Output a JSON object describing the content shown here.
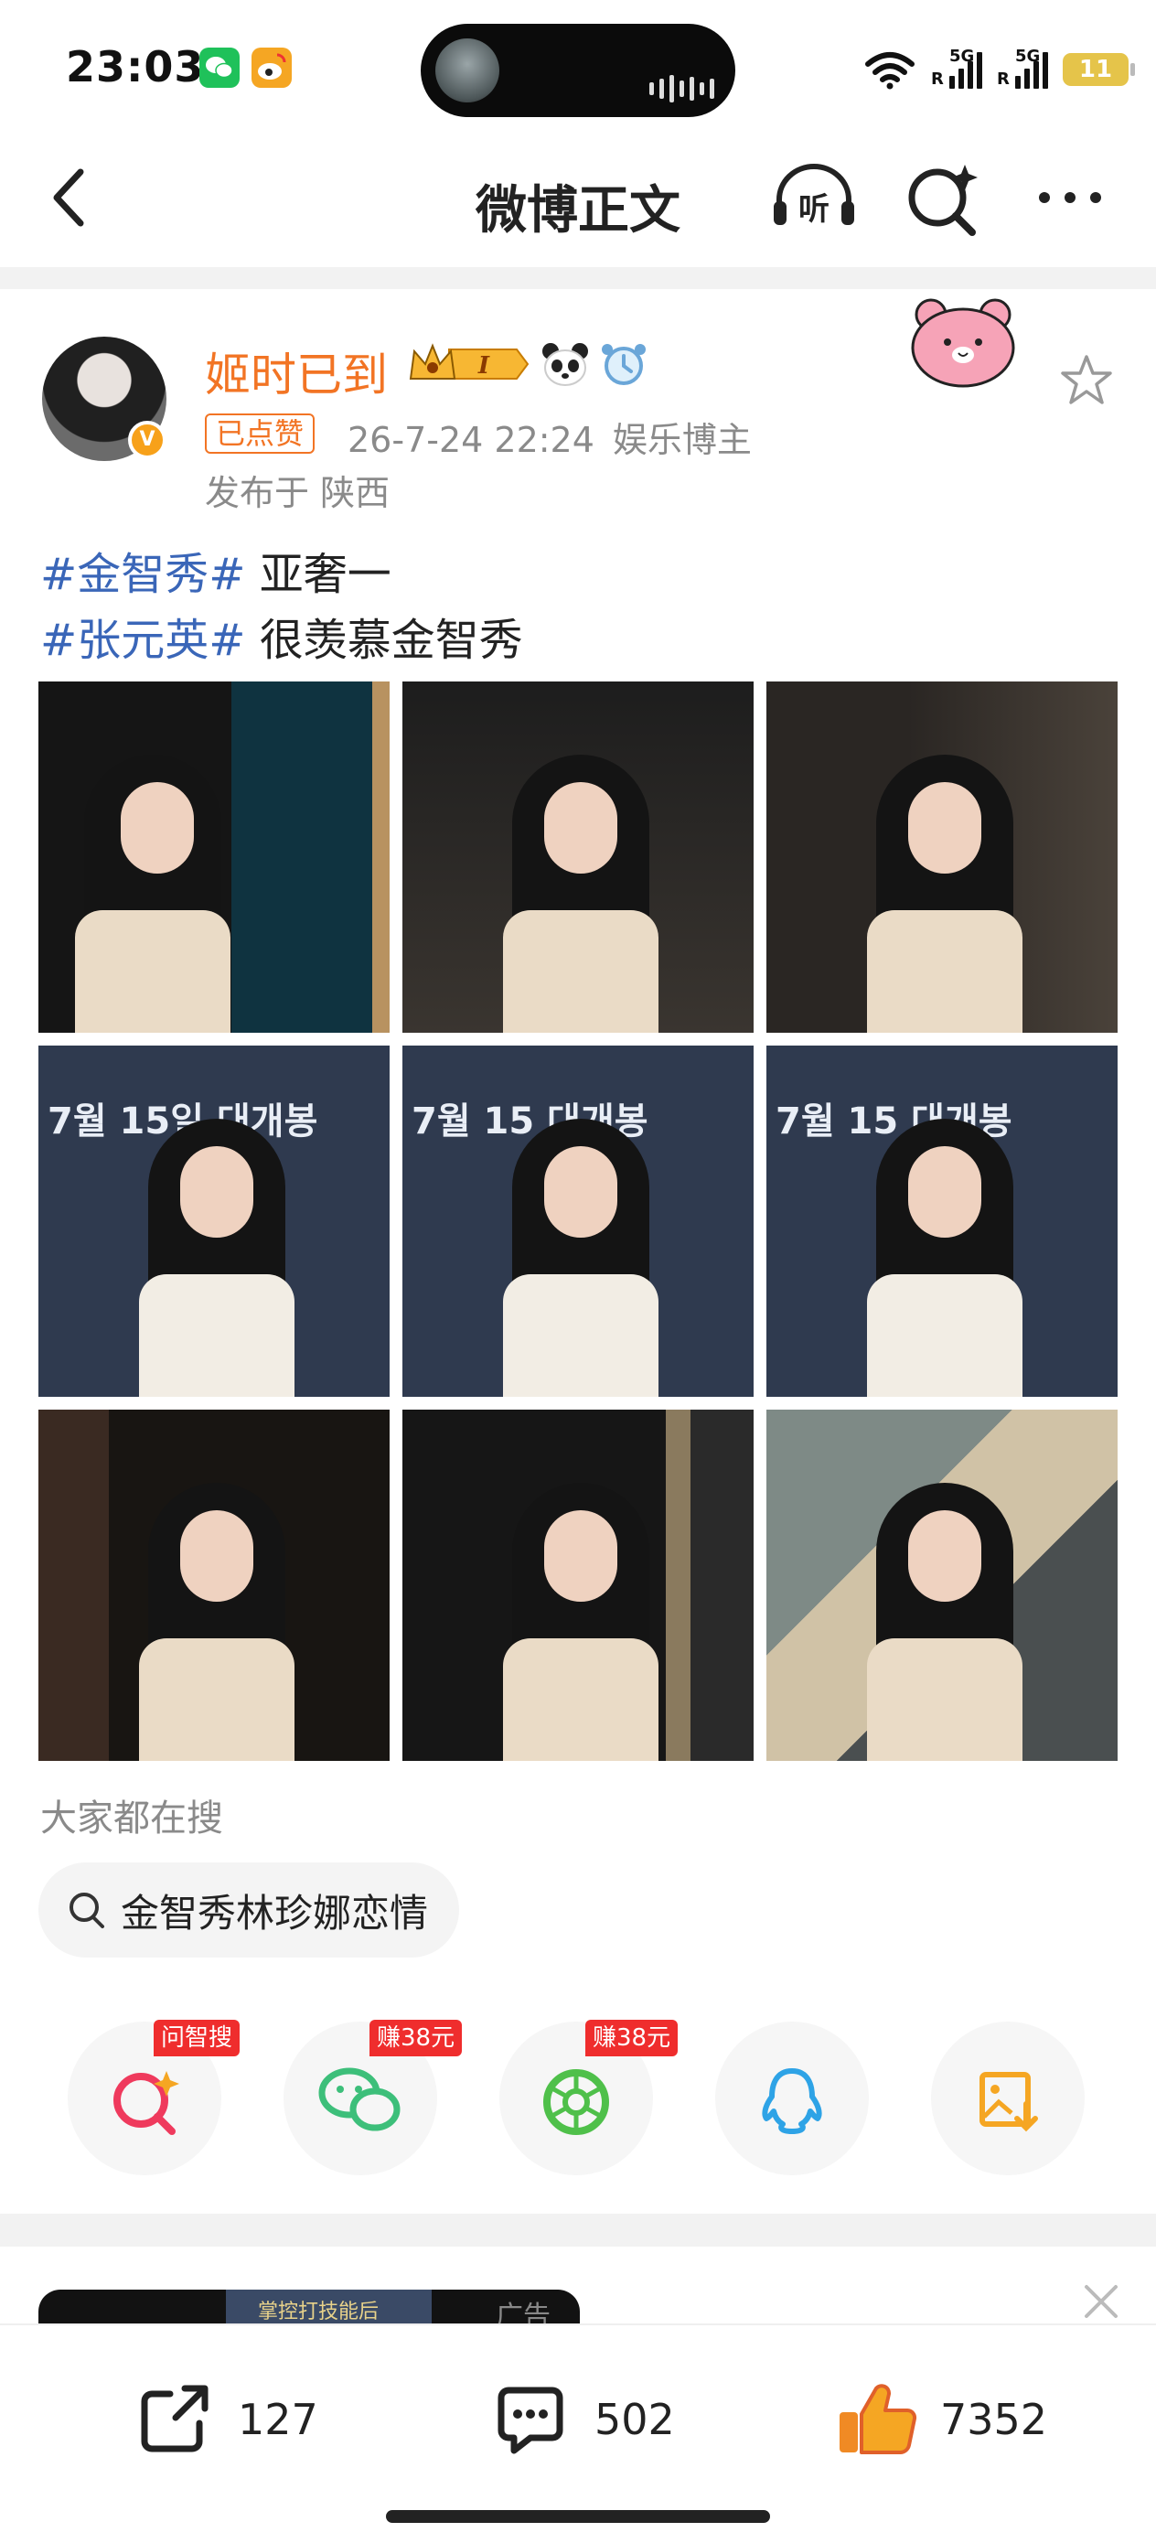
{
  "status_bar": {
    "time": "23:03",
    "battery": "11",
    "network_1": "5G",
    "network_2": "5G",
    "icons": [
      "wechat-icon",
      "weibo-icon",
      "wifi-icon",
      "signal-icon",
      "signal-icon",
      "battery-icon"
    ]
  },
  "nav": {
    "title": "微博正文",
    "listen_label": "听",
    "icons": [
      "back-icon",
      "listen-icon",
      "search-ai-icon",
      "more-icon"
    ]
  },
  "post": {
    "author": "姬时已到",
    "badge_level": "I",
    "liked_tag": "已点赞",
    "datetime": "26-7-24 22:24",
    "role": "娱乐博主",
    "location": "发布于 陕西",
    "verified_icon": "v-verified-icon",
    "lines": [
      {
        "tag": "#金智秀#",
        "text": " 亚奢一"
      },
      {
        "tag": "#张元英#",
        "text": " 很羡慕金智秀"
      }
    ],
    "image_text": {
      "date_text_1": "7월 15일",
      "date_text_2": "7월 15",
      "date_text_3": "7월 15",
      "headline": "대개봉"
    }
  },
  "trending": {
    "label": "大家都在搜",
    "query": "金智秀林珍娜恋情"
  },
  "share_targets": [
    {
      "name": "ai-search",
      "badge": "问智搜",
      "icon": "ai-search-icon",
      "color": "#ef3a5d"
    },
    {
      "name": "wechat",
      "badge": "赚38元",
      "icon": "wechat-icon",
      "color": "#3dbf7a"
    },
    {
      "name": "moments",
      "badge": "赚38元",
      "icon": "moments-icon",
      "color": "#4fc04a"
    },
    {
      "name": "qq",
      "badge": "",
      "icon": "qq-icon",
      "color": "#2ea3e6"
    },
    {
      "name": "save-image",
      "badge": "",
      "icon": "save-image-icon",
      "color": "#f5a623"
    }
  ],
  "ad": {
    "label": "广告",
    "text": "掌控打技能后"
  },
  "actions": {
    "repost": "127",
    "comment": "502",
    "like": "7352"
  },
  "colors": {
    "accent_orange": "#f27424",
    "hashtag_blue": "#3a66b8",
    "meta_gray": "#8a8a8a",
    "badge_red": "#ef2d2d"
  }
}
